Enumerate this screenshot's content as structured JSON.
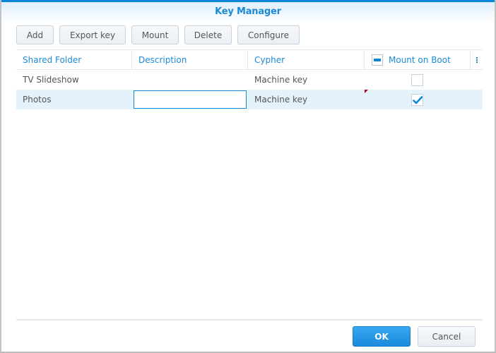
{
  "window": {
    "title": "Key Manager"
  },
  "toolbar": {
    "add_label": "Add",
    "export_key_label": "Export key",
    "mount_label": "Mount",
    "delete_label": "Delete",
    "configure_label": "Configure"
  },
  "grid": {
    "columns": [
      "Shared Folder",
      "Description",
      "Cypher",
      "Mount on Boot"
    ],
    "header_checkbox_state": "indeterminate",
    "rows": [
      {
        "shared_folder": "TV Slideshow",
        "description": "",
        "cypher": "Machine key",
        "mount_on_boot": false,
        "selected": false,
        "dirty": false
      },
      {
        "shared_folder": "Photos",
        "description": "",
        "cypher": "Machine key",
        "mount_on_boot": true,
        "selected": true,
        "dirty": true,
        "editing_description": true
      }
    ]
  },
  "footer": {
    "ok_label": "OK",
    "cancel_label": "Cancel"
  },
  "colors": {
    "accent": "#1a8ad6",
    "selected_row": "#e4f2fc",
    "dirty_marker": "#b3000f"
  }
}
